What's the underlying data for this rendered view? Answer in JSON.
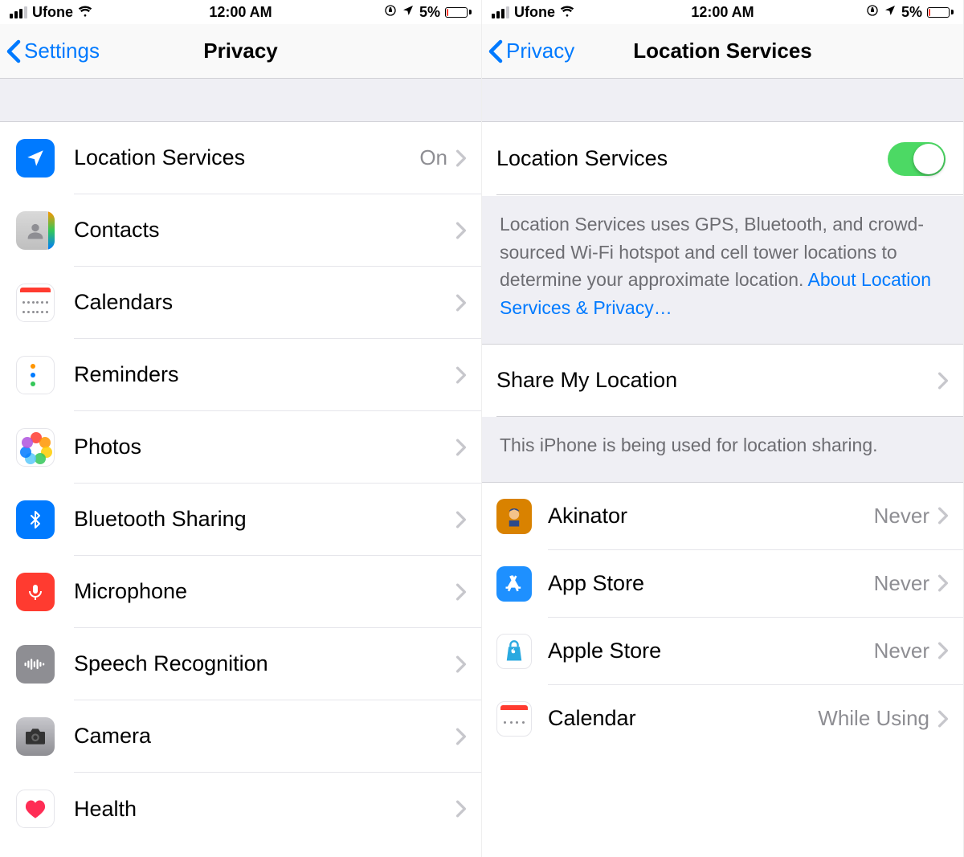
{
  "status": {
    "carrier": "Ufone",
    "time": "12:00 AM",
    "battery_pct": "5%"
  },
  "left": {
    "back_label": "Settings",
    "title": "Privacy",
    "rows": [
      {
        "icon": "location",
        "label": "Location Services",
        "value": "On"
      },
      {
        "icon": "contacts",
        "label": "Contacts"
      },
      {
        "icon": "calendars",
        "label": "Calendars"
      },
      {
        "icon": "reminders",
        "label": "Reminders"
      },
      {
        "icon": "photos",
        "label": "Photos"
      },
      {
        "icon": "bluetooth",
        "label": "Bluetooth Sharing"
      },
      {
        "icon": "mic",
        "label": "Microphone"
      },
      {
        "icon": "speech",
        "label": "Speech Recognition"
      },
      {
        "icon": "camera",
        "label": "Camera"
      },
      {
        "icon": "health",
        "label": "Health"
      }
    ]
  },
  "right": {
    "back_label": "Privacy",
    "title": "Location Services",
    "master_label": "Location Services",
    "master_toggle": true,
    "desc_text": "Location Services uses GPS, Bluetooth, and crowd-sourced Wi-Fi hotspot and cell tower locations to determine your approximate location. ",
    "desc_link": "About Location Services & Privacy…",
    "share_label": "Share My Location",
    "share_desc": "This iPhone is being used for location sharing.",
    "apps": [
      {
        "icon": "akinator",
        "label": "Akinator",
        "value": "Never"
      },
      {
        "icon": "appstore",
        "label": "App Store",
        "value": "Never"
      },
      {
        "icon": "applestore",
        "label": "Apple Store",
        "value": "Never"
      },
      {
        "icon": "calendar",
        "label": "Calendar",
        "value": "While Using"
      }
    ]
  }
}
